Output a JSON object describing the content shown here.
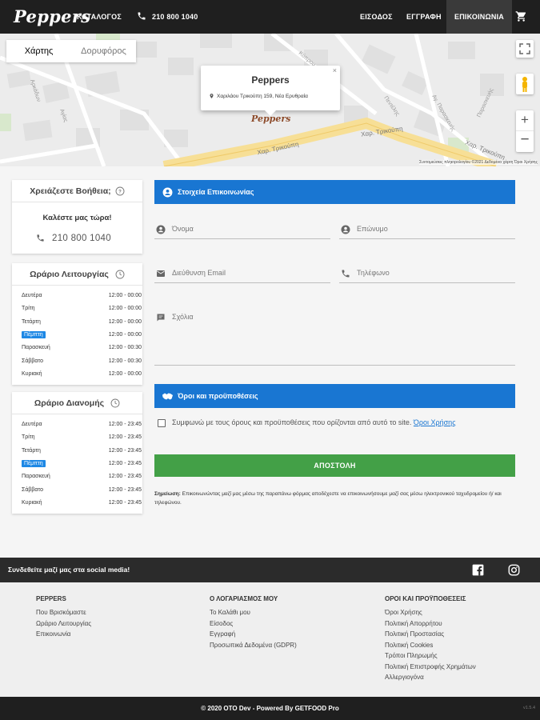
{
  "header": {
    "logo_text": "Peppers",
    "catalog_label": "ΚΑΤΑΛΟΓΟΣ",
    "phone": "210 800 1040",
    "login_label": "ΕΙΣΟΔΟΣ",
    "register_label": "ΕΓΓΡΑΦΗ",
    "contact_label": "ΕΠΙΚΟΙΝΩΝΙΑ",
    "cart_icon": "shopping-cart-icon"
  },
  "map": {
    "tab_map": "Χάρτης",
    "tab_satellite": "Δορυφόρος",
    "popup_title": "Peppers",
    "popup_address": "Χαριλάου Τρικούπη 159, Νέα Ερυθραία",
    "marker_label": "Peppers",
    "street_1": "Χαρ. Τρικούπη",
    "street_2": "Χαρ. Τρικούπη",
    "street_3": "Χαρ. Τρικούπη",
    "attribution": "Συντομεύσεις πληκτρολογίου   ©2021 Δεδομένα χάρτη   Όροι Χρήσης"
  },
  "help": {
    "title": "Χρειάζεστε Βοήθεια;",
    "call_now": "Καλέστε μας τώρα!",
    "phone": "210 800 1040"
  },
  "hours": {
    "title": "Ωράριο Λειτουργίας",
    "rows": [
      {
        "day": "Δευτέρα",
        "time": "12:00 - 00:00",
        "today": false
      },
      {
        "day": "Τρίτη",
        "time": "12:00 - 00:00",
        "today": false
      },
      {
        "day": "Τετάρτη",
        "time": "12:00 - 00:00",
        "today": false
      },
      {
        "day": "Πέμπτη",
        "time": "12:00 - 00:00",
        "today": true
      },
      {
        "day": "Παρασκευή",
        "time": "12:00 - 00:30",
        "today": false
      },
      {
        "day": "Σάββατο",
        "time": "12:00 - 00:30",
        "today": false
      },
      {
        "day": "Κυριακή",
        "time": "12:00 - 00:00",
        "today": false
      }
    ]
  },
  "delivery": {
    "title": "Ωράριο Διανομής",
    "rows": [
      {
        "day": "Δευτέρα",
        "time": "12:00 - 23:45",
        "today": false
      },
      {
        "day": "Τρίτη",
        "time": "12:00 - 23:45",
        "today": false
      },
      {
        "day": "Τετάρτη",
        "time": "12:00 - 23:45",
        "today": false
      },
      {
        "day": "Πέμπτη",
        "time": "12:00 - 23:45",
        "today": true
      },
      {
        "day": "Παρασκευή",
        "time": "12:00 - 23:45",
        "today": false
      },
      {
        "day": "Σάββατο",
        "time": "12:00 - 23:45",
        "today": false
      },
      {
        "day": "Κυριακή",
        "time": "12:00 - 23:45",
        "today": false
      }
    ]
  },
  "contact_form": {
    "section_title": "Στοιχεία Επικοινωνίας",
    "first_name_ph": "Όνομα",
    "last_name_ph": "Επώνυμο",
    "email_ph": "Διεύθυνση Email",
    "phone_ph": "Τηλέφωνο",
    "comments_ph": "Σχόλια",
    "terms_title": "Όροι και προϋποθέσεις",
    "terms_text": "Συμφωνώ με τους όρους και προϋποθέσεις που ορίζονται από αυτό το site.",
    "terms_link": "Όροι Χρήσης",
    "terms_checked": false,
    "submit_label": "ΑΠΟΣΤΟΛΗ",
    "note_bold": "Σημείωση:",
    "note_text": "Επικοινωνώντας μαζί μας μέσω της παραπάνω φόρμας αποδέχεστε να επικοινωνήσουμε μαζί σας μέσω ηλεκτρονικού ταχυδρομείου ή/ και τηλεφώνου."
  },
  "social": {
    "text": "Συνδεθείτε μαζί μας στα social media!",
    "facebook_icon": "facebook-icon",
    "instagram_icon": "instagram-icon"
  },
  "footer": {
    "col1": {
      "title": "PEPPERS",
      "items": [
        "Που Βρισκόμαστε",
        "Ωράριο Λειτουργίας",
        "Επικοινωνία"
      ]
    },
    "col2": {
      "title": "Ο ΛΟΓΑΡΙΑΣΜΟΣ ΜΟΥ",
      "items": [
        "Το Καλάθι μου",
        "Είσοδος",
        "Εγγραφή",
        "Προσωπικά Δεδομένα (GDPR)"
      ]
    },
    "col3": {
      "title": "ΟΡΟΙ ΚΑΙ ΠΡΟΫΠΟΘΕΣΕΙΣ",
      "items": [
        "Όροι Χρήσης",
        "Πολιτική Απορρήτου",
        "Πολιτική Προστασίας",
        "Πολιτική Cookies",
        "Τρόποι Πληρωμής",
        "Πολιτική Επιστροφής Χρημάτων",
        "Αλλεργιογόνα"
      ]
    },
    "copyright": "© 2020 OTO Dev - Powered By GETFOOD Pro",
    "version": "v1.5.4"
  },
  "colors": {
    "primary_blue": "#1976d2",
    "submit_green": "#43a047",
    "dark_bar": "#1f1f1f",
    "today_highlight": "#1e88e5"
  }
}
